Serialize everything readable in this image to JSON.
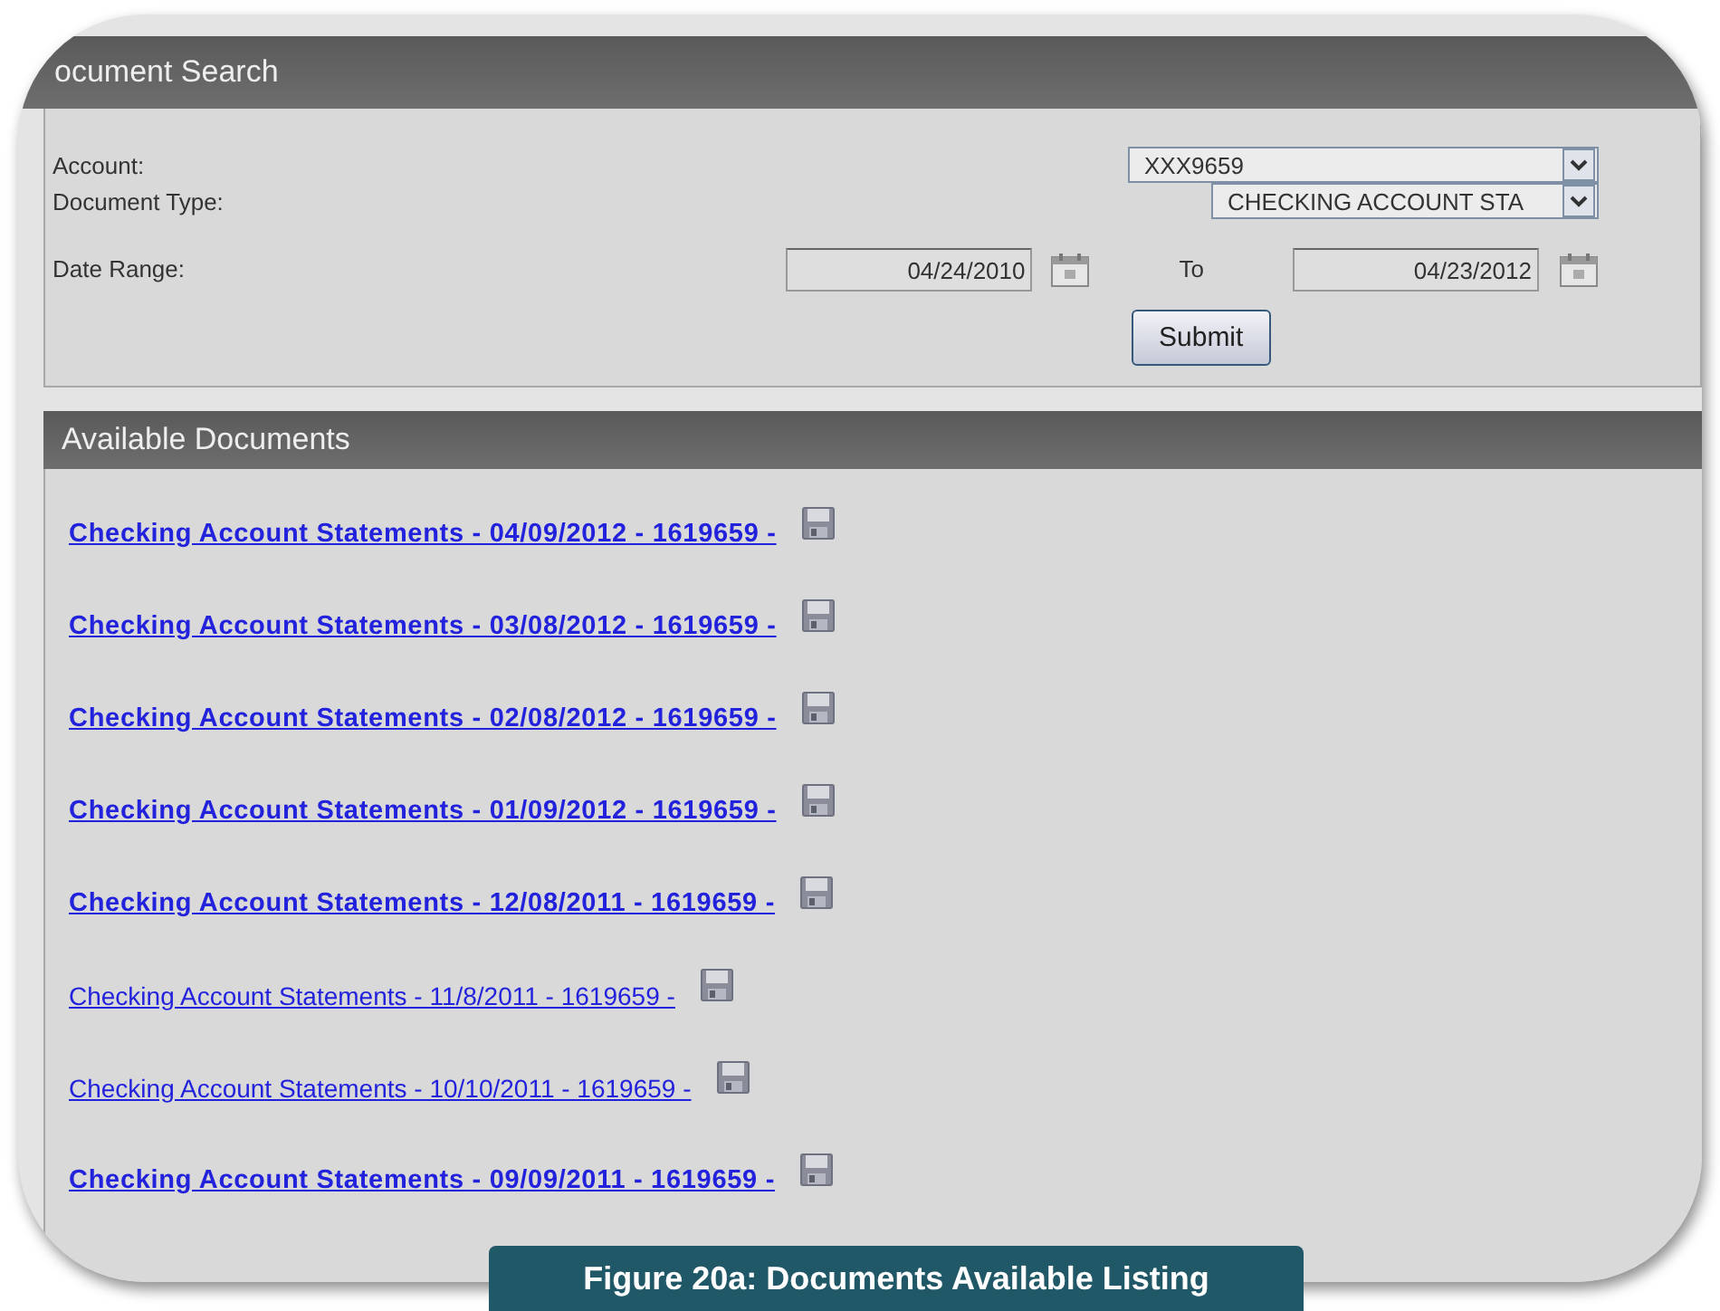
{
  "search_panel": {
    "title": "ocument Search",
    "fields": [
      {
        "kind": "select",
        "label": "Account:",
        "value": "XXX9659"
      },
      {
        "kind": "select",
        "label": "Document Type:",
        "value": "CHECKING ACCOUNT STA"
      },
      {
        "kind": "date_range",
        "label": "Date Range:",
        "from": "04/24/2010",
        "separator": "To",
        "to": "04/23/2012"
      }
    ],
    "submit": "Submit"
  },
  "documents": {
    "title": "Available Documents",
    "items": [
      {
        "label": "Checking Account Statements - 04/09/2012 - 1619659 -",
        "kind": "bold"
      },
      {
        "label": "Checking Account Statements - 03/08/2012 - 1619659 -",
        "kind": "bold"
      },
      {
        "label": "Checking Account Statements - 02/08/2012 - 1619659 -",
        "kind": "bold"
      },
      {
        "label": "Checking Account Statements - 01/09/2012 - 1619659 -",
        "kind": "bold"
      },
      {
        "label": "Checking Account Statements - 12/08/2011 - 1619659 -",
        "kind": "bold"
      },
      {
        "label": "Checking Account Statements - 11/8/2011 - 1619659 -",
        "kind": "plain"
      },
      {
        "label": "Checking Account Statements - 10/10/2011 - 1619659 -",
        "kind": "plain"
      },
      {
        "label": "Checking Account Statements - 09/09/2011 - 1619659 -",
        "kind": "bold"
      }
    ]
  },
  "caption": "Figure 20a: Documents Available Listing"
}
